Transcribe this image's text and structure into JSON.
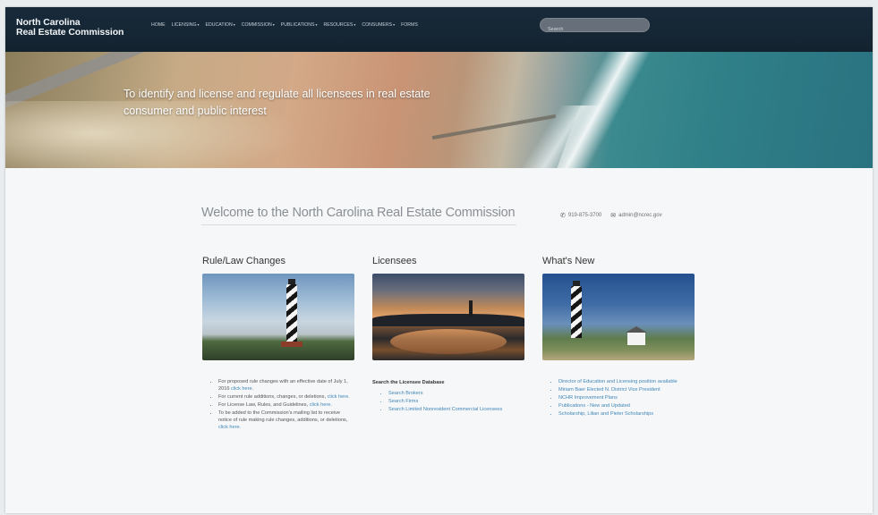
{
  "header": {
    "logo_line1": "North Carolina",
    "logo_line2": "Real Estate Commission",
    "nav": [
      {
        "label": "HOME",
        "dropdown": false
      },
      {
        "label": "LICENSING",
        "dropdown": true
      },
      {
        "label": "EDUCATION",
        "dropdown": true
      },
      {
        "label": "COMMISSION",
        "dropdown": true
      },
      {
        "label": "PUBLICATIONS",
        "dropdown": true
      },
      {
        "label": "RESOURCES",
        "dropdown": true
      },
      {
        "label": "CONSUMERS",
        "dropdown": true
      },
      {
        "label": "FORMS",
        "dropdown": false
      }
    ],
    "search_placeholder": "Search"
  },
  "hero": {
    "tagline": "To identify and license and regulate all licensees in real estate consumer and public interest"
  },
  "welcome": {
    "title": "Welcome to the North Carolina Real Estate Commission",
    "phone": "919-875-3700",
    "email": "admin@ncrec.gov",
    "phone_icon": "phone-icon",
    "email_icon": "envelope-icon"
  },
  "columns": {
    "rules": {
      "title": "Rule/Law Changes",
      "items": [
        {
          "text": "For proposed rule changes with an effective date of July 1, 2016 ",
          "link": "click here."
        },
        {
          "text": "For current rule additions, changes, or deletions, ",
          "link": "click here."
        },
        {
          "text": "For License Law, Rules, and Guidelines, ",
          "link": "click here."
        },
        {
          "text": "To be added to the Commission's mailing list to receive notice of rule making rule changes, additions, or deletions, ",
          "link": "click here."
        }
      ]
    },
    "licensees": {
      "title": "Licensees",
      "search_heading": "Search the Licensee Database",
      "links": [
        "Search Brokers",
        "Search Firms",
        "Search Limited Nonresident Commercial Licensees"
      ]
    },
    "news": {
      "title": "What's New",
      "links": [
        "Director of Education and Licensing position available",
        "Miriam Baer Elected N. District Vice President",
        "NCHR Improvement Plans",
        "Publications - New and Updated",
        "Scholarship, Lilian and Pieter Scholarships"
      ]
    }
  },
  "colors": {
    "header_bg": "#182b3b",
    "link": "#3f86b8",
    "page_bg": "#f6f7f8"
  }
}
